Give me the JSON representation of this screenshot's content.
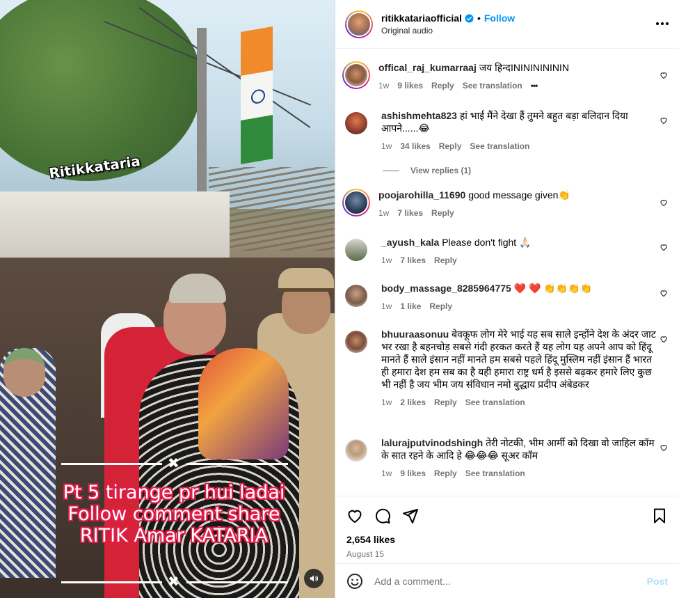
{
  "media": {
    "watermark": "Ritikkataria",
    "divider_symbol": "✖",
    "caption_lines": [
      "Pt 5 tirange pr hui ladai",
      "Follow comment share",
      "RITIK Amar KATARIA"
    ],
    "audio_icon": "speaker-icon"
  },
  "header": {
    "username": "ritikkatariaofficial",
    "follow_label": "Follow",
    "dot": "•",
    "subtitle": "Original audio",
    "verified_color": "#0095f6"
  },
  "comments": [
    {
      "user": "offical_raj_kumarraaj",
      "text": "जय हिन्दININININININ",
      "time": "1w",
      "likes": "9 likes",
      "reply": "Reply",
      "translate": "See translation",
      "more": "•••"
    },
    {
      "user": "ashishmehta823",
      "text": "हां भाई मैंने देखा हैं तुमने बहुत बड़ा बलिदान दिया आपने......😂",
      "time": "1w",
      "likes": "34 likes",
      "reply": "Reply",
      "translate": "See translation"
    },
    {
      "user": "poojarohilla_11690",
      "text": "good message given👏",
      "time": "1w",
      "likes": "7 likes",
      "reply": "Reply"
    },
    {
      "user": "_ayush_kala",
      "text": "Please don't fight 🙏🏻",
      "time": "1w",
      "likes": "7 likes",
      "reply": "Reply"
    },
    {
      "user": "body_massage_8285964775",
      "text": "❤️ ❤️ 👏👏👏👏",
      "time": "1w",
      "likes": "1 like",
      "reply": "Reply"
    },
    {
      "user": "bhuuraasonuu",
      "text": "बेवकूफ लोग मेरे भाई यह सब साले इन्होंने देश के अंदर जाट भर रखा है बहनचोड़ सबसे गंदी हरकत करते हैं यह लोग यह अपने आप को हिंदू मानते हैं साले इंसान नहीं मानते हम सबसे पहले हिंदू मुस्लिम नहीं इंसान हैं भारत ही हमारा देश हम सब का है यही हमारा राष्ट्र धर्म है इससे बढ़कर हमारे लिए कुछ भी नहीं है जय भीम जय संविधान नमो बुद्धाय प्रदीप अंबेडकर",
      "time": "1w",
      "likes": "2 likes",
      "reply": "Reply",
      "translate": "See translation"
    },
    {
      "user": "lalurajputvinodshingh",
      "text": "तेरी नोटकी, भीम आर्मी को दिखा वो जाहिल कॉम के सात रहने के आदि हे 😂😂😂 सूअर कॉम",
      "time": "1w",
      "likes": "9 likes",
      "reply": "Reply",
      "translate": "See translation"
    }
  ],
  "view_replies": "View replies (1)",
  "actions": {
    "likes": "2,654 likes",
    "date": "August 15",
    "comment_placeholder": "Add a comment...",
    "post_label": "Post"
  },
  "colors": {
    "accent": "#0095f6",
    "caption_outline": "#e11d48",
    "heart_red": "#ed4956"
  }
}
